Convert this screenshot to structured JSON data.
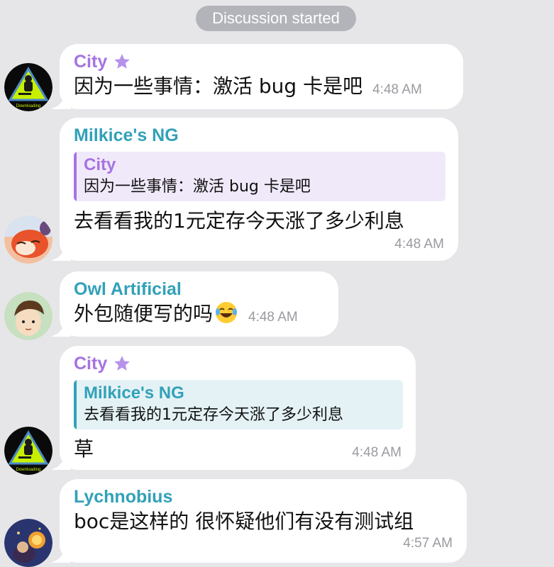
{
  "service_message": "Discussion started",
  "colors": {
    "background": "#e6e6e9",
    "bubble": "#ffffff",
    "name_purple": "#a673e0",
    "name_teal": "#31a1b8",
    "time_gray": "#9a9aa0",
    "pill": "#b2b4b9"
  },
  "messages": [
    {
      "sender": "City",
      "badge_icon": "star-icon",
      "text": "因为一些事情：激活 bug 卡是吧",
      "time": "4:48 AM",
      "avatar_caption": "Downloading"
    },
    {
      "sender": "Milkice's NG",
      "reply_to": {
        "name": "City",
        "text": "因为一些事情：激活 bug 卡是吧"
      },
      "text": "去看看我的1元定存今天涨了多少利息",
      "time": "4:48 AM"
    },
    {
      "sender": "Owl Artificial",
      "text": "外包随便写的吗",
      "emoji": "laughing-tears-emoji",
      "time": "4:48 AM"
    },
    {
      "sender": "City",
      "badge_icon": "star-icon",
      "reply_to": {
        "name": "Milkice's NG",
        "text": "去看看我的1元定存今天涨了多少利息"
      },
      "text": "草",
      "time": "4:48 AM",
      "avatar_caption": "Downloading"
    },
    {
      "sender": "Lychnobius",
      "text": "boc是这样的 很怀疑他们有没有测试组",
      "time": "4:57 AM"
    }
  ]
}
